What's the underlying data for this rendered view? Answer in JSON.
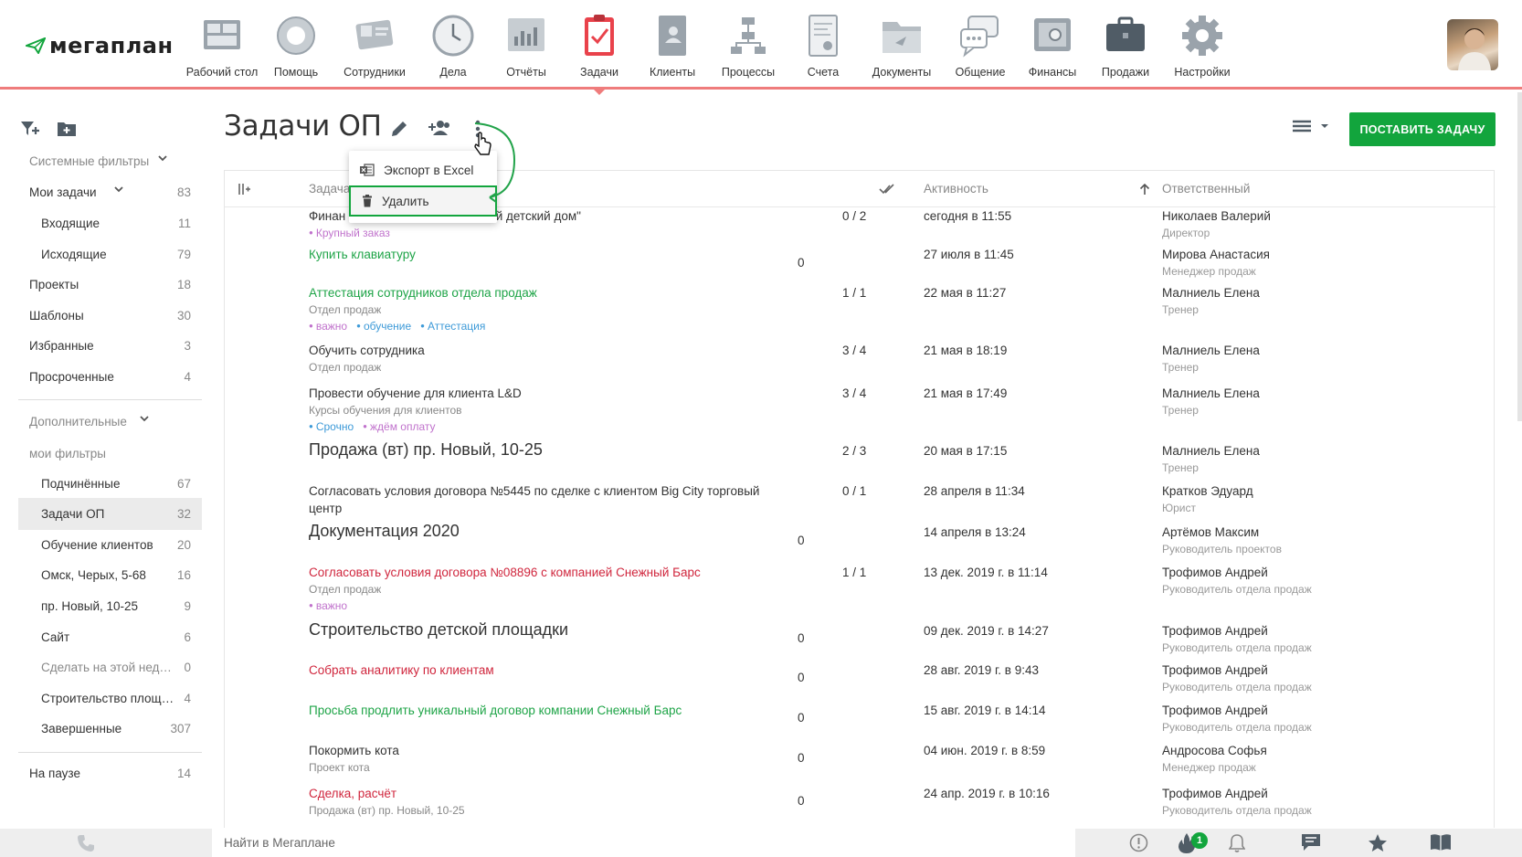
{
  "app": {
    "logo_text": "мегаплан"
  },
  "nav": [
    {
      "label": "Рабочий стол",
      "icon": "desktop-icon"
    },
    {
      "label": "Помощь",
      "icon": "lifebuoy-icon"
    },
    {
      "label": "Сотрудники",
      "icon": "employees-card-icon"
    },
    {
      "label": "Дела",
      "icon": "clock-icon"
    },
    {
      "label": "Отчёты",
      "icon": "report-chart-icon"
    },
    {
      "label": "Задачи",
      "icon": "clipboard-check-icon",
      "active": true
    },
    {
      "label": "Клиенты",
      "icon": "contact-book-icon"
    },
    {
      "label": "Процессы",
      "icon": "process-flow-icon"
    },
    {
      "label": "Счета",
      "icon": "invoice-icon"
    },
    {
      "label": "Документы",
      "icon": "folder-icon"
    },
    {
      "label": "Общение",
      "icon": "chat-bubbles-icon"
    },
    {
      "label": "Финансы",
      "icon": "safe-icon"
    },
    {
      "label": "Продажи",
      "icon": "briefcase-icon"
    },
    {
      "label": "Настройки",
      "icon": "gear-icon"
    }
  ],
  "sidebar": {
    "system_filters": "Системные фильтры",
    "my_tasks": {
      "label": "Мои задачи",
      "count": "83"
    },
    "incoming": {
      "label": "Входящие",
      "count": "11"
    },
    "outgoing": {
      "label": "Исходящие",
      "count": "79"
    },
    "projects": {
      "label": "Проекты",
      "count": "18"
    },
    "templates": {
      "label": "Шаблоны",
      "count": "30"
    },
    "favorites": {
      "label": "Избранные",
      "count": "3"
    },
    "overdue": {
      "label": "Просроченные",
      "count": "4"
    },
    "additional": "Дополнительные",
    "my_filters": "мои фильтры",
    "filters": [
      {
        "label": "Подчинённые",
        "count": "67"
      },
      {
        "label": "Задачи ОП",
        "count": "32",
        "active": true
      },
      {
        "label": "Обучение клиентов",
        "count": "20"
      },
      {
        "label": "Омск, Черых, 5-68",
        "count": "16"
      },
      {
        "label": "пр. Новый, 10-25",
        "count": "9"
      },
      {
        "label": "Сайт",
        "count": "6"
      },
      {
        "label": "Сделать на этой нед…",
        "count": "0",
        "gray": true
      },
      {
        "label": "Строительство площ…",
        "count": "4"
      },
      {
        "label": "Завершенные",
        "count": "307"
      }
    ],
    "paused": {
      "label": "На паузе",
      "count": "14"
    }
  },
  "header": {
    "title": "Задачи ОП",
    "new_task_button": "ПОСТАВИТЬ ЗАДАЧУ"
  },
  "dropdown": {
    "export": "Экспорт в Excel",
    "delete": "Удалить"
  },
  "table": {
    "columns": {
      "task": "Задача",
      "activity": "Активность",
      "responsible": "Ответственный"
    },
    "rows": [
      {
        "title_left": "Финан",
        "title_right": "ый детский дом\"",
        "style": "normal",
        "sub": "",
        "tags": [
          {
            "text": "Крупный заказ",
            "color": "purple"
          }
        ],
        "progress": "0 / 2",
        "activity": "сегодня в 11:55",
        "name": "Николаев Валерий",
        "role": "Директор"
      },
      {
        "title": "Купить клавиатуру",
        "style": "green",
        "sub": "",
        "tags": [],
        "progress": "",
        "zero": "0",
        "activity": "27 июля в 11:45",
        "name": "Мирова Анастасия",
        "role": "Менеджер продаж"
      },
      {
        "title": "Аттестация сотрудников отдела продаж",
        "style": "green",
        "sub": "Отдел продаж",
        "tags": [
          {
            "text": "важно",
            "color": "purple"
          },
          {
            "text": "обучение",
            "color": "blue"
          },
          {
            "text": "Аттестация",
            "color": "blue"
          }
        ],
        "progress": "1 / 1",
        "activity": "22 мая в 11:27",
        "name": "Малниель Елена",
        "role": "Тренер"
      },
      {
        "title": "Обучить сотрудника",
        "style": "normal",
        "sub": "Отдел продаж",
        "tags": [],
        "progress": "3 / 4",
        "activity": "21 мая в 18:19",
        "name": "Малниель Елена",
        "role": "Тренер"
      },
      {
        "title": "Провести обучение для клиента L&D",
        "style": "normal",
        "sub": "Курсы обучения для клиентов",
        "tags": [
          {
            "text": "Срочно",
            "color": "blue"
          },
          {
            "text": "ждём оплату",
            "color": "purple"
          }
        ],
        "progress": "3 / 4",
        "activity": "21 мая в 17:49",
        "name": "Малниель Елена",
        "role": "Тренер"
      },
      {
        "title": "Продажа (вт) пр. Новый, 10-25",
        "style": "big",
        "sub": "",
        "tags": [],
        "progress": "2 / 3",
        "activity": "20 мая в 17:15",
        "name": "Малниель Елена",
        "role": "Тренер"
      },
      {
        "title": "Согласовать условия договора №5445 по сделке с клиентом Big City торговый",
        "title2": "центр",
        "style": "normal",
        "sub": "",
        "tags": [],
        "progress": "0 / 1",
        "activity": "28 апреля в 11:34",
        "name": "Кратков Эдуард",
        "role": "Юрист"
      },
      {
        "title": "Документация 2020",
        "style": "big",
        "sub": "",
        "tags": [],
        "progress": "",
        "zero": "0",
        "activity": "14 апреля в 13:24",
        "name": "Артёмов Максим",
        "role": "Руководитель проектов"
      },
      {
        "title": "Согласовать условия договора №08896 с компанией Снежный Барс",
        "style": "red",
        "sub": "Отдел продаж",
        "tags": [
          {
            "text": "важно",
            "color": "purple"
          }
        ],
        "progress": "1 / 1",
        "activity": "13 дек. 2019 г. в 11:14",
        "name": "Трофимов Андрей",
        "role": "Руководитель отдела продаж"
      },
      {
        "title": "Строительство детской площадки",
        "style": "big",
        "sub": "",
        "tags": [],
        "progress": "",
        "zero": "0",
        "activity": "09 дек. 2019 г. в 14:27",
        "name": "Трофимов Андрей",
        "role": "Руководитель отдела продаж"
      },
      {
        "title": "Собрать аналитику по клиентам",
        "style": "red",
        "sub": "",
        "tags": [],
        "progress": "",
        "zero": "0",
        "activity": "28 авг. 2019 г. в 9:43",
        "name": "Трофимов Андрей",
        "role": "Руководитель отдела продаж"
      },
      {
        "title": "Просьба продлить уникальный договор компании Снежный Барс",
        "style": "green",
        "sub": "",
        "tags": [],
        "progress": "",
        "zero": "0",
        "activity": "15 авг. 2019 г. в 14:14",
        "name": "Трофимов Андрей",
        "role": "Руководитель отдела продаж"
      },
      {
        "title": "Покормить кота",
        "style": "normal",
        "sub": "Проект кота",
        "tags": [],
        "progress": "",
        "zero": "0",
        "activity": "04 июн. 2019 г. в 8:59",
        "name": "Андросова Софья",
        "role": "Менеджер продаж"
      },
      {
        "title": "Сделка, расчёт",
        "style": "red",
        "sub": "Продажа (вт) пр. Новый, 10-25",
        "tags": [],
        "progress": "",
        "zero": "0",
        "activity": "24 апр. 2019 г. в 10:16",
        "name": "Трофимов Андрей",
        "role": "Руководитель отдела продаж"
      }
    ]
  },
  "bottombar": {
    "search_placeholder": "Найти в Мегаплане",
    "fire_badge": "1"
  },
  "colors": {
    "accent_green": "#12a53d",
    "nav_underline": "#ef7c7c",
    "task_green": "#1ea447",
    "task_red": "#d0263d",
    "tag_purple": "#c072cc",
    "tag_blue": "#3d9ad8"
  }
}
